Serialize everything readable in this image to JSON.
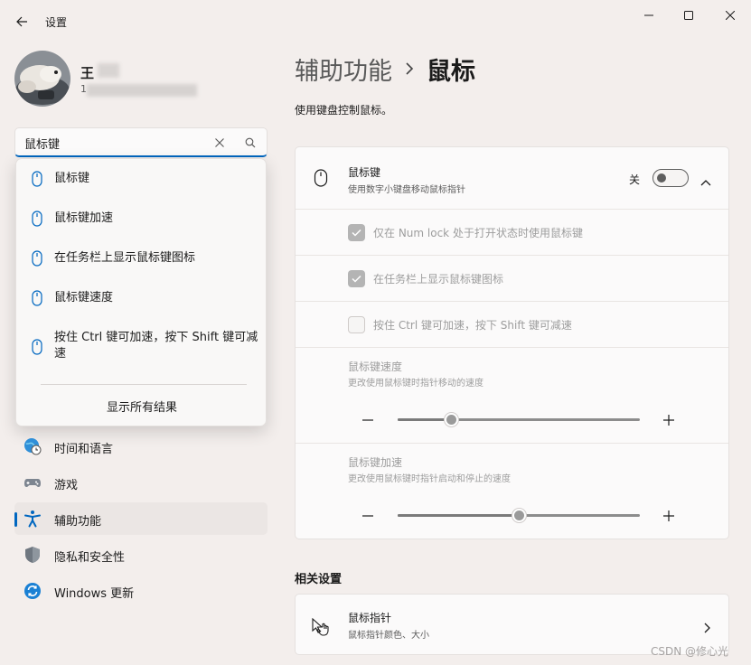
{
  "window": {
    "title": "设置",
    "back_icon": "arrow-left-icon",
    "minimize_icon": "minimize-icon",
    "maximize_icon": "maximize-icon",
    "close_icon": "close-icon"
  },
  "profile": {
    "name_visible": "王",
    "email_visible": "1"
  },
  "search": {
    "value": "鼠标键",
    "suggestions": [
      {
        "label": "鼠标键",
        "icon": "mouse-icon"
      },
      {
        "label": "鼠标键加速",
        "icon": "mouse-icon"
      },
      {
        "label": "在任务栏上显示鼠标键图标",
        "icon": "mouse-icon"
      },
      {
        "label": "鼠标键速度",
        "icon": "mouse-icon"
      },
      {
        "label": "按住 Ctrl 键可加速，按下 Shift 键可减速",
        "icon": "mouse-icon"
      }
    ],
    "show_all": "显示所有结果"
  },
  "nav": {
    "items": [
      {
        "label": "时间和语言",
        "icon": "globe-clock-icon",
        "active": false
      },
      {
        "label": "游戏",
        "icon": "gamepad-icon",
        "active": false
      },
      {
        "label": "辅助功能",
        "icon": "accessibility-icon",
        "active": true
      },
      {
        "label": "隐私和安全性",
        "icon": "shield-icon",
        "active": false
      },
      {
        "label": "Windows 更新",
        "icon": "update-icon",
        "active": false
      }
    ]
  },
  "content": {
    "breadcrumb_parent": "辅助功能",
    "breadcrumb_current": "鼠标",
    "description": "使用键盘控制鼠标。",
    "mouse_keys": {
      "title": "鼠标键",
      "subtitle": "使用数字小键盘移动鼠标指针",
      "state_label": "关",
      "on": false
    },
    "options": [
      {
        "label": "仅在 Num lock 处于打开状态时使用鼠标键",
        "checked": true
      },
      {
        "label": "在任务栏上显示鼠标键图标",
        "checked": true
      },
      {
        "label": "按住 Ctrl 键可加速，按下 Shift 键可减速",
        "checked": false
      }
    ],
    "speed": {
      "title": "鼠标键速度",
      "subtitle": "更改使用鼠标键时指针移动的速度",
      "value": 0.22
    },
    "acceleration": {
      "title": "鼠标键加速",
      "subtitle": "更改使用鼠标键时指针启动和停止的速度",
      "value": 0.5
    },
    "related_title": "相关设置",
    "pointer": {
      "title": "鼠标指针",
      "subtitle": "鼠标指针颜色、大小"
    }
  },
  "watermark": "CSDN @修心光",
  "colors": {
    "accent": "#0067c0",
    "background": "#f3eeec",
    "card": "#fbfafa"
  }
}
